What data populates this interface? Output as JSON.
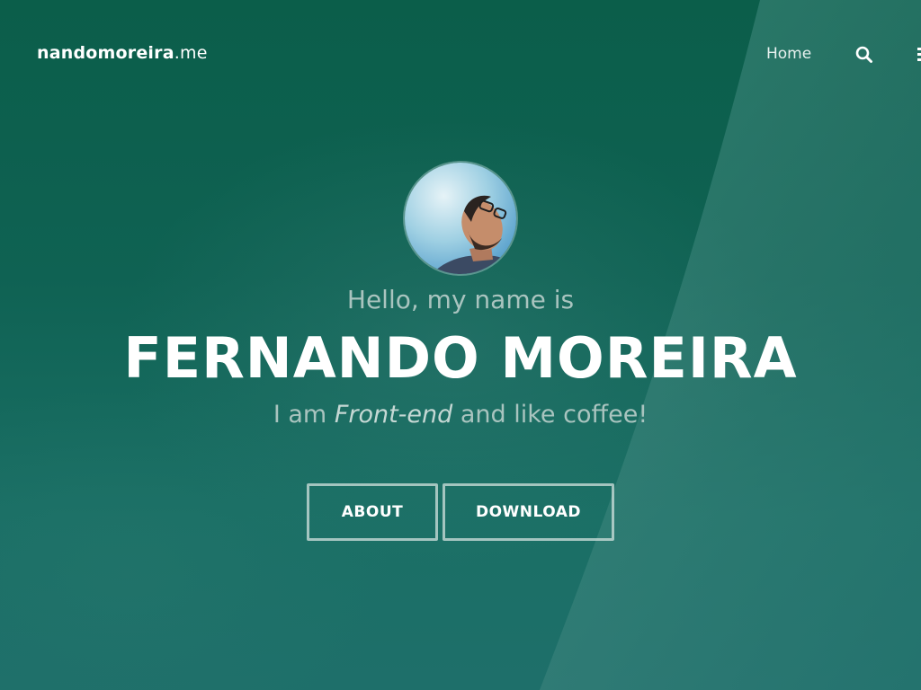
{
  "header": {
    "logo_bold": "nandomoreira",
    "logo_suffix": ".me",
    "nav_home_label": "Home",
    "search_icon": "search-icon",
    "menu_icon": "menu-icon"
  },
  "hero": {
    "greeting": "Hello, my name is",
    "name": "FERNANDO MOREIRA",
    "tagline_prefix": "I am ",
    "tagline_emphasis": "Front-end",
    "tagline_suffix": " and like coffee!",
    "buttons": {
      "about_label": "ABOUT",
      "download_label": "DOWNLOAD"
    }
  },
  "colors": {
    "background_top": "#0b5e4a",
    "background_bottom": "#1e6f6a",
    "text_primary": "#ffffff",
    "text_muted": "#a9c4bf"
  }
}
